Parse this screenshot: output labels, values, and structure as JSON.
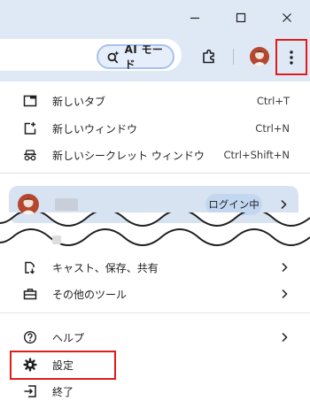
{
  "toolbar": {
    "ai_mode_label": "AI モード"
  },
  "menu": {
    "new_tab": {
      "label": "新しいタブ",
      "shortcut": "Ctrl+T"
    },
    "new_window": {
      "label": "新しいウィンドウ",
      "shortcut": "Ctrl+N"
    },
    "new_incognito": {
      "label": "新しいシークレット ウィンドウ",
      "shortcut": "Ctrl+Shift+N"
    },
    "profile": {
      "status": "ログイン中"
    },
    "cast_save_share": {
      "label": "キャスト、保存、共有"
    },
    "more_tools": {
      "label": "その他のツール"
    },
    "help": {
      "label": "ヘルプ"
    },
    "settings": {
      "label": "設定"
    },
    "exit": {
      "label": "終了"
    }
  },
  "colors": {
    "toolbar_bg": "#dfe9f5",
    "highlight_red": "#e01b1b",
    "profile_card_bg": "#d8e3f1",
    "login_badge_bg": "#c3d7f1",
    "ai_chip_border": "#a6c3ee"
  },
  "icons": {
    "window": [
      "minimize-icon",
      "maximize-icon",
      "close-icon"
    ],
    "toolbar": [
      "sparkle-search-icon",
      "extensions-icon",
      "profile-avatar-icon",
      "more-vert-icon"
    ],
    "menu": [
      "new-tab-icon",
      "new-window-icon",
      "incognito-icon",
      "cast-icon",
      "toolbox-icon",
      "help-icon",
      "gear-icon",
      "exit-icon",
      "chevron-right-icon"
    ]
  }
}
